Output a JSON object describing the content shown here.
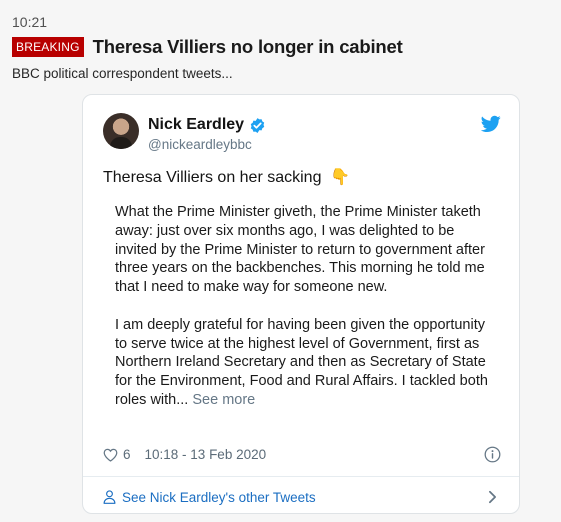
{
  "post": {
    "time": "10:21",
    "badge": "BREAKING",
    "headline": "Theresa Villiers no longer in cabinet",
    "subline": "BBC political correspondent tweets..."
  },
  "tweet": {
    "author_name": "Nick Eardley",
    "handle": "@nickeardleybbc",
    "text": "Theresa Villiers on her sacking",
    "emoji": "👇",
    "quote_paragraph_1": "What the Prime Minister giveth, the Prime Minister taketh away: just over six months ago, I was delighted to be invited by the Prime Minister to return to government after three years on the backbenches. This morning he told me that I need to make way for someone new.",
    "quote_paragraph_2": "I am deeply grateful for having been given the opportunity to serve twice at the highest level of Government, first as Northern Ireland Secretary and then as Secretary of State for the Environment, Food and Rural Affairs. I tackled both roles with...",
    "see_more": "See more",
    "likes": "6",
    "timestamp": "10:18 - 13 Feb 2020",
    "footer_link": "See Nick Eardley's other Tweets"
  },
  "icons": {
    "verified": "verified-badge-icon",
    "bird": "twitter-bird-icon",
    "heart": "heart-icon",
    "info": "info-icon",
    "person": "person-icon",
    "chevron": "chevron-right-icon"
  },
  "colors": {
    "breaking_red": "#b80000",
    "twitter_blue": "#1da1f2",
    "link_blue": "#1b6ec2"
  }
}
